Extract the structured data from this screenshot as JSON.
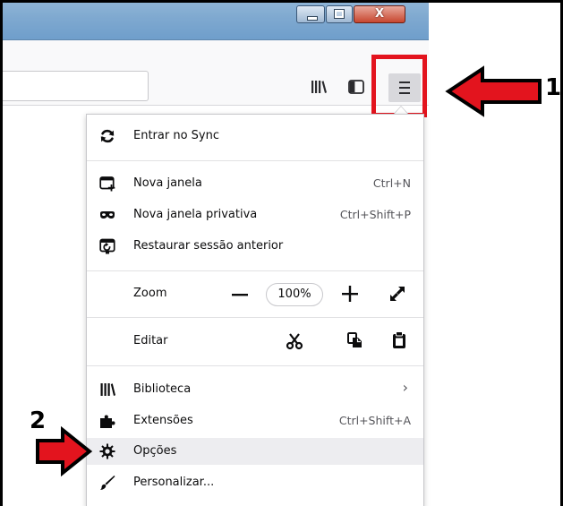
{
  "window": {
    "close_glyph": "X"
  },
  "menu": {
    "sync": {
      "label": "Entrar no Sync"
    },
    "new_window": {
      "label": "Nova janela",
      "shortcut": "Ctrl+N"
    },
    "private_window": {
      "label": "Nova janela privativa",
      "shortcut": "Ctrl+Shift+P"
    },
    "restore": {
      "label": "Restaurar sessão anterior"
    },
    "zoom": {
      "label": "Zoom",
      "minus": "−",
      "value": "100%",
      "plus": "+"
    },
    "edit": {
      "label": "Editar"
    },
    "library": {
      "label": "Biblioteca",
      "chevron": "›"
    },
    "addons": {
      "label": "Extensões",
      "shortcut": "Ctrl+Shift+A"
    },
    "options": {
      "label": "Opções"
    },
    "customize": {
      "label": "Personalizar..."
    }
  },
  "annotations": {
    "step1": "1",
    "step2": "2"
  },
  "colors": {
    "highlight_red": "#e3141e",
    "panel_bg": "#ffffff",
    "hover_bg": "#ededf0"
  }
}
